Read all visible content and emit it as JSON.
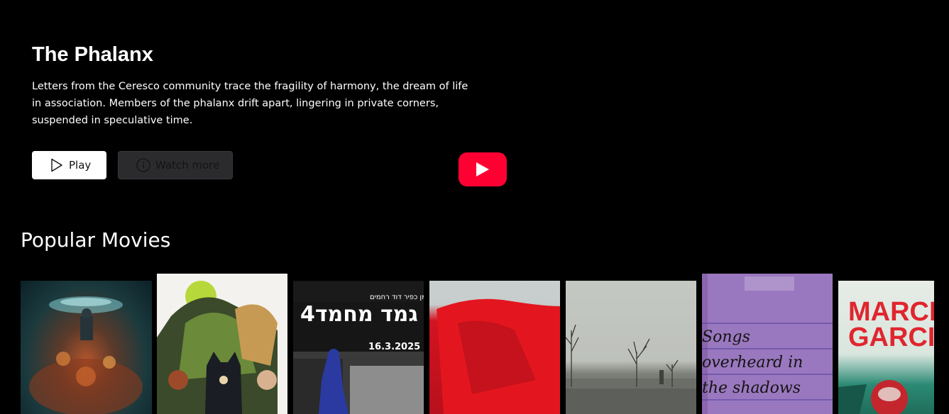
{
  "hero": {
    "title": "The Phalanx",
    "description": "Letters from the Ceresco community trace the fragility of harmony, the dream of life in association. Members of the phalanx drift apart, lingering in private corners, suspended in speculative time.",
    "play_label": "Play",
    "watch_more_label": "Watch more"
  },
  "icons": {
    "play": "play-outline-icon",
    "info": "info-circle-icon",
    "youtube": "youtube-play-icon"
  },
  "colors": {
    "background": "#000000",
    "youtube_red": "#ff0033",
    "play_button": "#ffffff",
    "watch_more_button": "#2b2b2e"
  },
  "section": {
    "title": "Popular Movies"
  },
  "posters": {
    "p3": {
      "main": "גמד מחמד4",
      "date": "16.3.2025",
      "credit": "כרווי ולייש כריסמן   כפיר דוד רחמים"
    },
    "p6": {
      "text": "Songs overheard in the shadows"
    },
    "p7": {
      "title": "MARCIA GARCIA"
    }
  }
}
